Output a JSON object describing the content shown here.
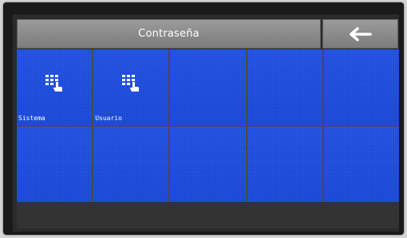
{
  "header": {
    "title": "Contraseña",
    "back_icon": "arrow-left-icon"
  },
  "grid": {
    "cells": [
      {
        "label": "Sistema",
        "icon": "keypad-touch-icon"
      },
      {
        "label": "Usuario",
        "icon": "keypad-touch-icon"
      },
      {
        "label": ""
      },
      {
        "label": ""
      },
      {
        "label": ""
      },
      {
        "label": ""
      },
      {
        "label": ""
      },
      {
        "label": ""
      },
      {
        "label": ""
      },
      {
        "label": ""
      }
    ]
  },
  "colors": {
    "tile_blue": "#1f4fe0",
    "header_gray": "#8c8c8c",
    "text": "#ffffff"
  }
}
